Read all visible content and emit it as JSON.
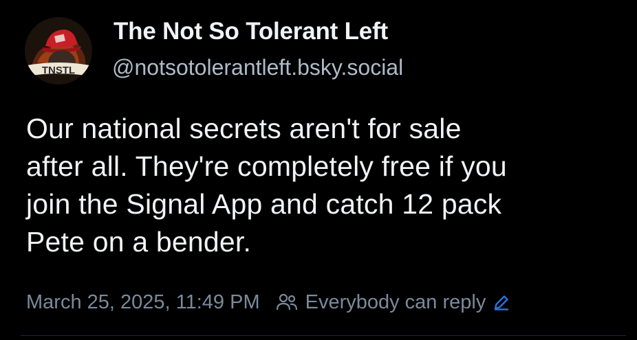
{
  "author": {
    "display_name": "The Not So Tolerant Left",
    "handle": "@notsotolerantleft.bsky.social",
    "avatar_icon": "avatar-image",
    "avatar_text": "TNSTL"
  },
  "post": {
    "text": "Our national secrets aren't for sale\nafter all.  They're completely free if you\njoin the Signal App and catch 12 pack\nPete on a bender."
  },
  "meta": {
    "timestamp": "March 25, 2025, 11:49 PM",
    "reply_setting": "Everybody can reply",
    "reply_icon": "people-icon",
    "edit_icon": "pencil-icon"
  },
  "colors": {
    "background": "#000000",
    "text_primary": "#f1f3f5",
    "text_handle": "#aebbc9",
    "text_meta": "#7b8a9c",
    "accent": "#2f6fe0"
  }
}
